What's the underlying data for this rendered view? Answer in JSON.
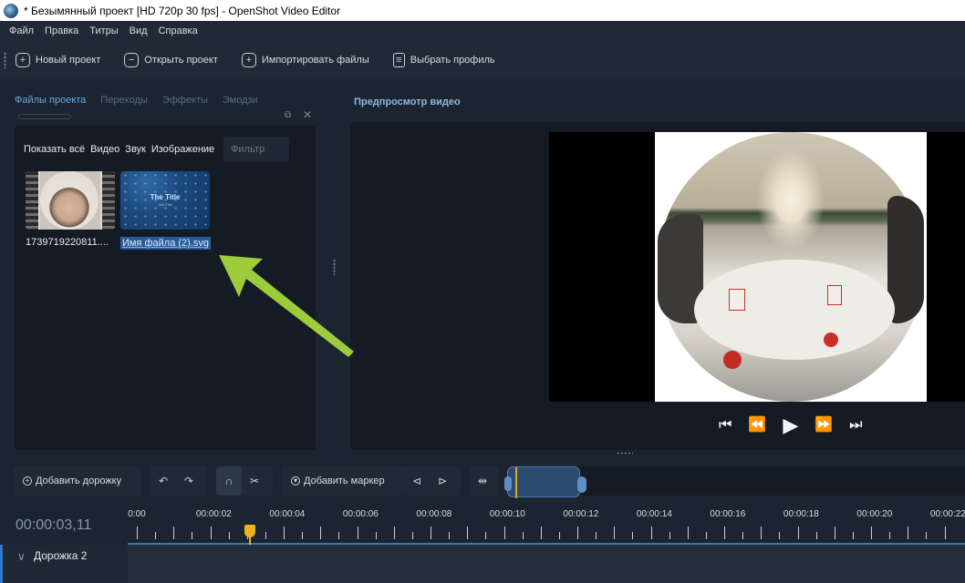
{
  "window": {
    "title": "* Безымянный проект [HD 720p 30 fps] - OpenShot Video Editor"
  },
  "menu": [
    "Файл",
    "Правка",
    "Титры",
    "Вид",
    "Справка"
  ],
  "toolbar": {
    "new_project": "Новый проект",
    "open_project": "Открыть проект",
    "import_files": "Импортировать файлы",
    "choose_profile": "Выбрать профиль"
  },
  "left_tabs": [
    "Файлы проекта",
    "Переходы",
    "Эффекты",
    "Эмодзи"
  ],
  "filters": {
    "show_all": "Показать всё",
    "video": "Видео",
    "audio": "Звук",
    "image": "Изображение",
    "filter_placeholder": "Фильтр"
  },
  "files": [
    {
      "name": "1739719220811....",
      "kind": "video"
    },
    {
      "name": "Имя файла (2).svg",
      "kind": "title",
      "thumb_title": "The Title",
      "thumb_subtitle": "Sub-Title",
      "selected": true
    }
  ],
  "preview": {
    "heading": "Предпросмотр видео"
  },
  "timeline": {
    "add_track": "Добавить дорожку",
    "add_marker": "Добавить маркер",
    "current_time": "00:00:03,11",
    "ticks": [
      "0:00",
      "00:00:02",
      "00:00:04",
      "00:00:06",
      "00:00:08",
      "00:00:10",
      "00:00:12",
      "00:00:14",
      "00:00:16",
      "00:00:18",
      "00:00:20",
      "00:00:22"
    ],
    "tracks": [
      {
        "name": "Дорожка 2"
      }
    ]
  },
  "colors": {
    "accent": "#2e7ad0",
    "playhead": "#f0b020",
    "arrow": "#9ccc3c"
  }
}
